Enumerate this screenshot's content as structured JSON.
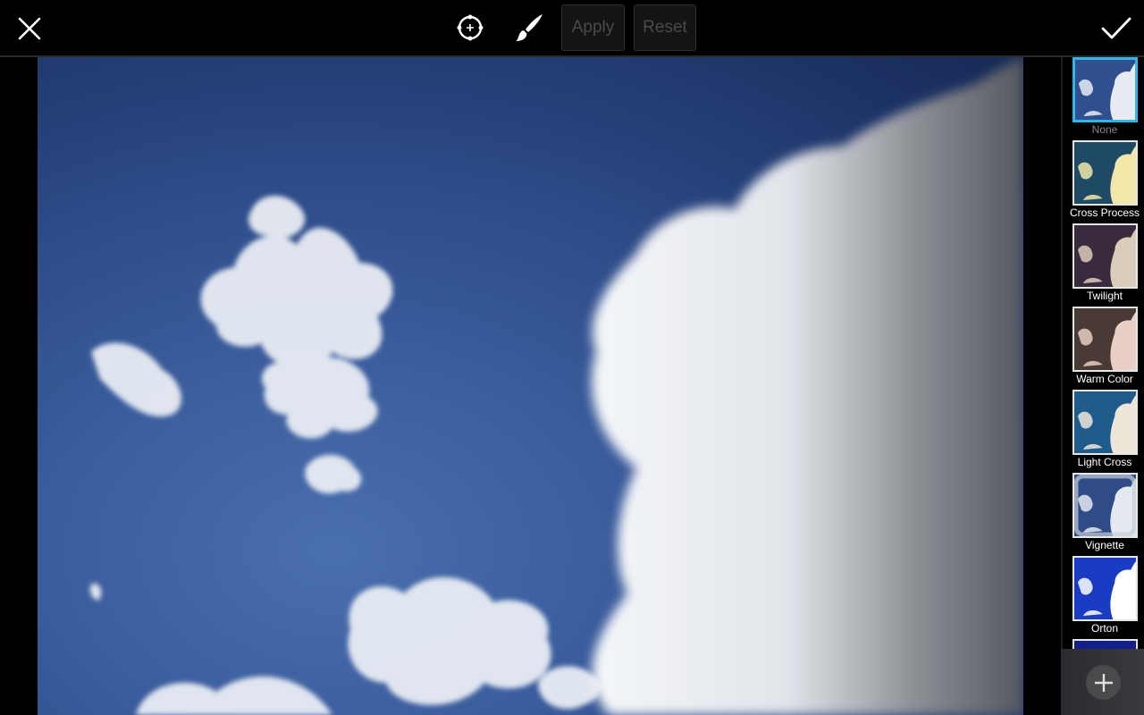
{
  "toolbar": {
    "close_icon": "close-icon",
    "target_icon": "crosshair-target-icon",
    "brush_icon": "brush-icon",
    "apply_label": "Apply",
    "reset_label": "Reset",
    "confirm_icon": "checkmark-icon"
  },
  "photo": {
    "subject": "blue sky with white clouds"
  },
  "filters": {
    "selected": "None",
    "selected_color": "#33b5e5",
    "items": [
      {
        "label": "None",
        "tint": "#2f4f8f",
        "cloud": "#e8ecf2"
      },
      {
        "label": "Cross Process",
        "tint": "#1f4a66",
        "cloud": "#f2e7a8"
      },
      {
        "label": "Twilight",
        "tint": "#3a2a3e",
        "cloud": "#d9ccb8"
      },
      {
        "label": "Warm Color",
        "tint": "#4a3a36",
        "cloud": "#e9cfc4"
      },
      {
        "label": "Light Cross",
        "tint": "#1f5c8c",
        "cloud": "#efe6da"
      },
      {
        "label": "Vignette",
        "tint": "#2f4c86",
        "cloud": "#e4e8ef"
      },
      {
        "label": "Orton",
        "tint": "#1a3cc4",
        "cloud": "#ffffff"
      },
      {
        "label": "",
        "tint": "#14208a",
        "cloud": "#c8c8a0"
      }
    ]
  },
  "add_button": {
    "icon": "plus-icon"
  }
}
